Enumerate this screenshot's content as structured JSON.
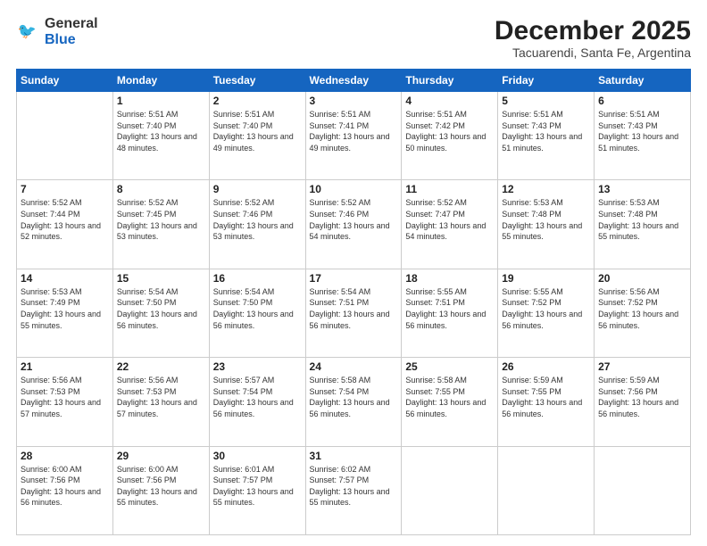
{
  "logo": {
    "line1": "General",
    "line2": "Blue"
  },
  "title": "December 2025",
  "subtitle": "Tacuarendi, Santa Fe, Argentina",
  "days_of_week": [
    "Sunday",
    "Monday",
    "Tuesday",
    "Wednesday",
    "Thursday",
    "Friday",
    "Saturday"
  ],
  "weeks": [
    [
      {
        "day": "",
        "sunrise": "",
        "sunset": "",
        "daylight": ""
      },
      {
        "day": "1",
        "sunrise": "Sunrise: 5:51 AM",
        "sunset": "Sunset: 7:40 PM",
        "daylight": "Daylight: 13 hours and 48 minutes."
      },
      {
        "day": "2",
        "sunrise": "Sunrise: 5:51 AM",
        "sunset": "Sunset: 7:40 PM",
        "daylight": "Daylight: 13 hours and 49 minutes."
      },
      {
        "day": "3",
        "sunrise": "Sunrise: 5:51 AM",
        "sunset": "Sunset: 7:41 PM",
        "daylight": "Daylight: 13 hours and 49 minutes."
      },
      {
        "day": "4",
        "sunrise": "Sunrise: 5:51 AM",
        "sunset": "Sunset: 7:42 PM",
        "daylight": "Daylight: 13 hours and 50 minutes."
      },
      {
        "day": "5",
        "sunrise": "Sunrise: 5:51 AM",
        "sunset": "Sunset: 7:43 PM",
        "daylight": "Daylight: 13 hours and 51 minutes."
      },
      {
        "day": "6",
        "sunrise": "Sunrise: 5:51 AM",
        "sunset": "Sunset: 7:43 PM",
        "daylight": "Daylight: 13 hours and 51 minutes."
      }
    ],
    [
      {
        "day": "7",
        "sunrise": "Sunrise: 5:52 AM",
        "sunset": "Sunset: 7:44 PM",
        "daylight": "Daylight: 13 hours and 52 minutes."
      },
      {
        "day": "8",
        "sunrise": "Sunrise: 5:52 AM",
        "sunset": "Sunset: 7:45 PM",
        "daylight": "Daylight: 13 hours and 53 minutes."
      },
      {
        "day": "9",
        "sunrise": "Sunrise: 5:52 AM",
        "sunset": "Sunset: 7:46 PM",
        "daylight": "Daylight: 13 hours and 53 minutes."
      },
      {
        "day": "10",
        "sunrise": "Sunrise: 5:52 AM",
        "sunset": "Sunset: 7:46 PM",
        "daylight": "Daylight: 13 hours and 54 minutes."
      },
      {
        "day": "11",
        "sunrise": "Sunrise: 5:52 AM",
        "sunset": "Sunset: 7:47 PM",
        "daylight": "Daylight: 13 hours and 54 minutes."
      },
      {
        "day": "12",
        "sunrise": "Sunrise: 5:53 AM",
        "sunset": "Sunset: 7:48 PM",
        "daylight": "Daylight: 13 hours and 55 minutes."
      },
      {
        "day": "13",
        "sunrise": "Sunrise: 5:53 AM",
        "sunset": "Sunset: 7:48 PM",
        "daylight": "Daylight: 13 hours and 55 minutes."
      }
    ],
    [
      {
        "day": "14",
        "sunrise": "Sunrise: 5:53 AM",
        "sunset": "Sunset: 7:49 PM",
        "daylight": "Daylight: 13 hours and 55 minutes."
      },
      {
        "day": "15",
        "sunrise": "Sunrise: 5:54 AM",
        "sunset": "Sunset: 7:50 PM",
        "daylight": "Daylight: 13 hours and 56 minutes."
      },
      {
        "day": "16",
        "sunrise": "Sunrise: 5:54 AM",
        "sunset": "Sunset: 7:50 PM",
        "daylight": "Daylight: 13 hours and 56 minutes."
      },
      {
        "day": "17",
        "sunrise": "Sunrise: 5:54 AM",
        "sunset": "Sunset: 7:51 PM",
        "daylight": "Daylight: 13 hours and 56 minutes."
      },
      {
        "day": "18",
        "sunrise": "Sunrise: 5:55 AM",
        "sunset": "Sunset: 7:51 PM",
        "daylight": "Daylight: 13 hours and 56 minutes."
      },
      {
        "day": "19",
        "sunrise": "Sunrise: 5:55 AM",
        "sunset": "Sunset: 7:52 PM",
        "daylight": "Daylight: 13 hours and 56 minutes."
      },
      {
        "day": "20",
        "sunrise": "Sunrise: 5:56 AM",
        "sunset": "Sunset: 7:52 PM",
        "daylight": "Daylight: 13 hours and 56 minutes."
      }
    ],
    [
      {
        "day": "21",
        "sunrise": "Sunrise: 5:56 AM",
        "sunset": "Sunset: 7:53 PM",
        "daylight": "Daylight: 13 hours and 57 minutes."
      },
      {
        "day": "22",
        "sunrise": "Sunrise: 5:56 AM",
        "sunset": "Sunset: 7:53 PM",
        "daylight": "Daylight: 13 hours and 57 minutes."
      },
      {
        "day": "23",
        "sunrise": "Sunrise: 5:57 AM",
        "sunset": "Sunset: 7:54 PM",
        "daylight": "Daylight: 13 hours and 56 minutes."
      },
      {
        "day": "24",
        "sunrise": "Sunrise: 5:58 AM",
        "sunset": "Sunset: 7:54 PM",
        "daylight": "Daylight: 13 hours and 56 minutes."
      },
      {
        "day": "25",
        "sunrise": "Sunrise: 5:58 AM",
        "sunset": "Sunset: 7:55 PM",
        "daylight": "Daylight: 13 hours and 56 minutes."
      },
      {
        "day": "26",
        "sunrise": "Sunrise: 5:59 AM",
        "sunset": "Sunset: 7:55 PM",
        "daylight": "Daylight: 13 hours and 56 minutes."
      },
      {
        "day": "27",
        "sunrise": "Sunrise: 5:59 AM",
        "sunset": "Sunset: 7:56 PM",
        "daylight": "Daylight: 13 hours and 56 minutes."
      }
    ],
    [
      {
        "day": "28",
        "sunrise": "Sunrise: 6:00 AM",
        "sunset": "Sunset: 7:56 PM",
        "daylight": "Daylight: 13 hours and 56 minutes."
      },
      {
        "day": "29",
        "sunrise": "Sunrise: 6:00 AM",
        "sunset": "Sunset: 7:56 PM",
        "daylight": "Daylight: 13 hours and 55 minutes."
      },
      {
        "day": "30",
        "sunrise": "Sunrise: 6:01 AM",
        "sunset": "Sunset: 7:57 PM",
        "daylight": "Daylight: 13 hours and 55 minutes."
      },
      {
        "day": "31",
        "sunrise": "Sunrise: 6:02 AM",
        "sunset": "Sunset: 7:57 PM",
        "daylight": "Daylight: 13 hours and 55 minutes."
      },
      {
        "day": "",
        "sunrise": "",
        "sunset": "",
        "daylight": ""
      },
      {
        "day": "",
        "sunrise": "",
        "sunset": "",
        "daylight": ""
      },
      {
        "day": "",
        "sunrise": "",
        "sunset": "",
        "daylight": ""
      }
    ]
  ]
}
